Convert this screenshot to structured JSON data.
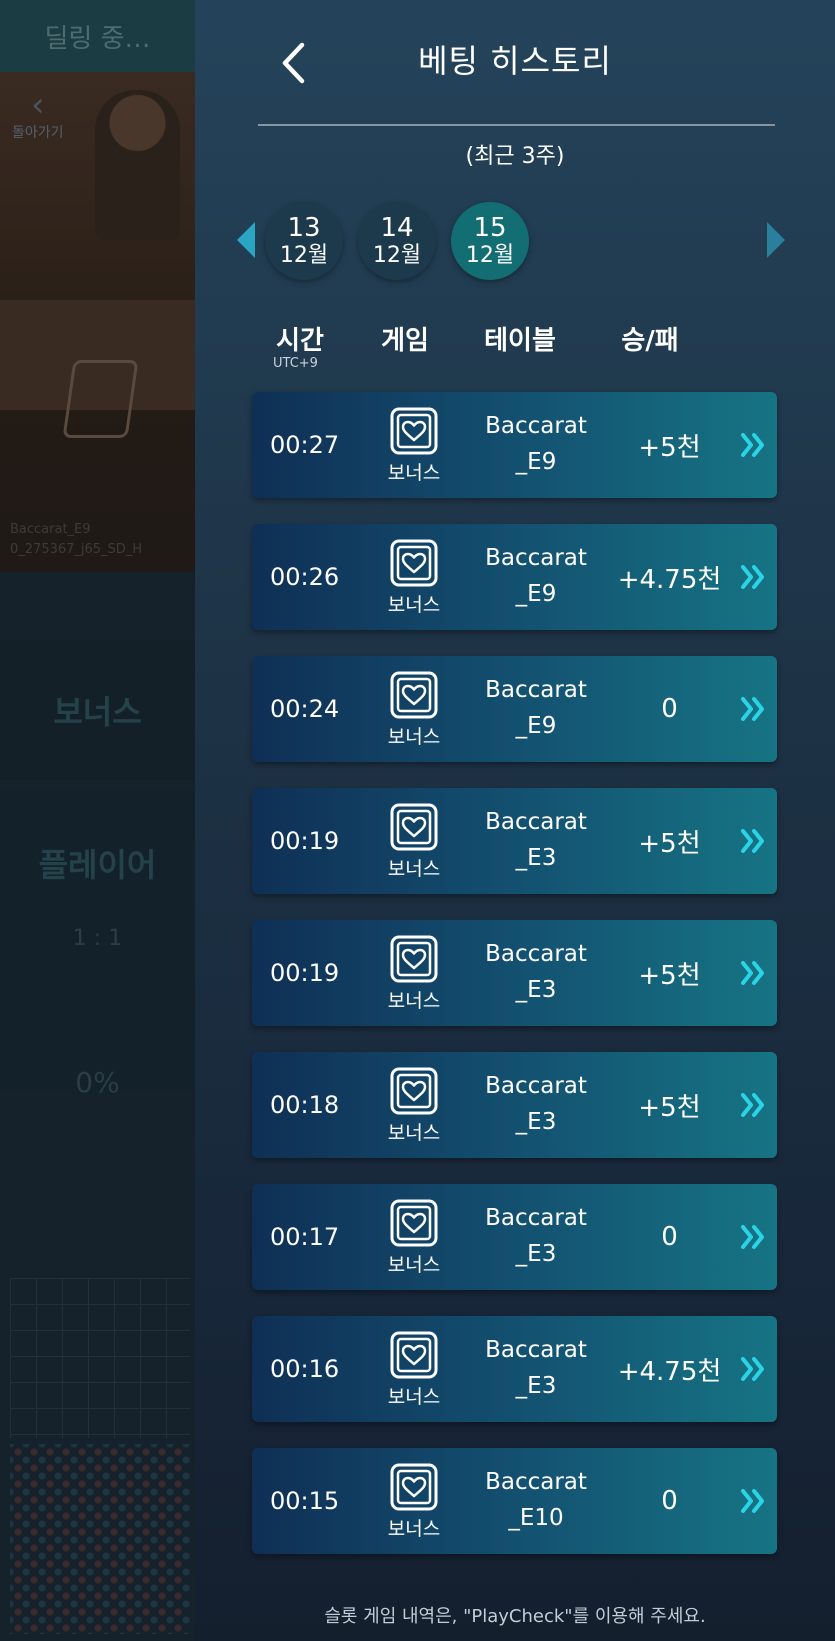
{
  "background": {
    "header_text": "딜링 중…",
    "back_label": "돌아가기",
    "table_name_line1": "Baccarat_E9",
    "table_name_line2": "0_275367_j65_SD_H",
    "bonus_label": "보너스",
    "player_label": "플레이어",
    "player_odds": "1 : 1",
    "player_percent": "0%"
  },
  "panel": {
    "title": "베팅 히스토리",
    "period": "(최근 3주)",
    "dates": [
      {
        "day": "13",
        "month": "12월"
      },
      {
        "day": "14",
        "month": "12월"
      },
      {
        "day": "15",
        "month": "12월"
      }
    ],
    "selected_date_index": 2,
    "columns": {
      "time": "시간",
      "timezone": "UTC+9",
      "game": "게임",
      "table": "테이블",
      "result": "승/패"
    },
    "rows": [
      {
        "time": "00:27",
        "game": "보너스",
        "table_line1": "Baccarat",
        "table_line2": "_E9",
        "result": "+5천"
      },
      {
        "time": "00:26",
        "game": "보너스",
        "table_line1": "Baccarat",
        "table_line2": "_E9",
        "result": "+4.75천"
      },
      {
        "time": "00:24",
        "game": "보너스",
        "table_line1": "Baccarat",
        "table_line2": "_E9",
        "result": "0"
      },
      {
        "time": "00:19",
        "game": "보너스",
        "table_line1": "Baccarat",
        "table_line2": "_E3",
        "result": "+5천"
      },
      {
        "time": "00:19",
        "game": "보너스",
        "table_line1": "Baccarat",
        "table_line2": "_E3",
        "result": "+5천"
      },
      {
        "time": "00:18",
        "game": "보너스",
        "table_line1": "Baccarat",
        "table_line2": "_E3",
        "result": "+5천"
      },
      {
        "time": "00:17",
        "game": "보너스",
        "table_line1": "Baccarat",
        "table_line2": "_E3",
        "result": "0"
      },
      {
        "time": "00:16",
        "game": "보너스",
        "table_line1": "Baccarat",
        "table_line2": "_E3",
        "result": "+4.75천"
      },
      {
        "time": "00:15",
        "game": "보너스",
        "table_line1": "Baccarat",
        "table_line2": "_E10",
        "result": "0"
      }
    ],
    "footer_note": "슬롯 게임 내역은, \"PlayCheck\"를 이용해 주세요."
  },
  "icons": {
    "back": "chevron-left-icon",
    "prev_date": "triangle-left-icon",
    "next_date": "triangle-right-icon",
    "game": "card-heart-icon",
    "row_detail": "double-chevron-right-icon"
  },
  "colors": {
    "accent": "#2ad4e6",
    "selected_date": "#136e74",
    "row_gradient_start": "#0f2f55",
    "row_gradient_end": "#167484"
  }
}
